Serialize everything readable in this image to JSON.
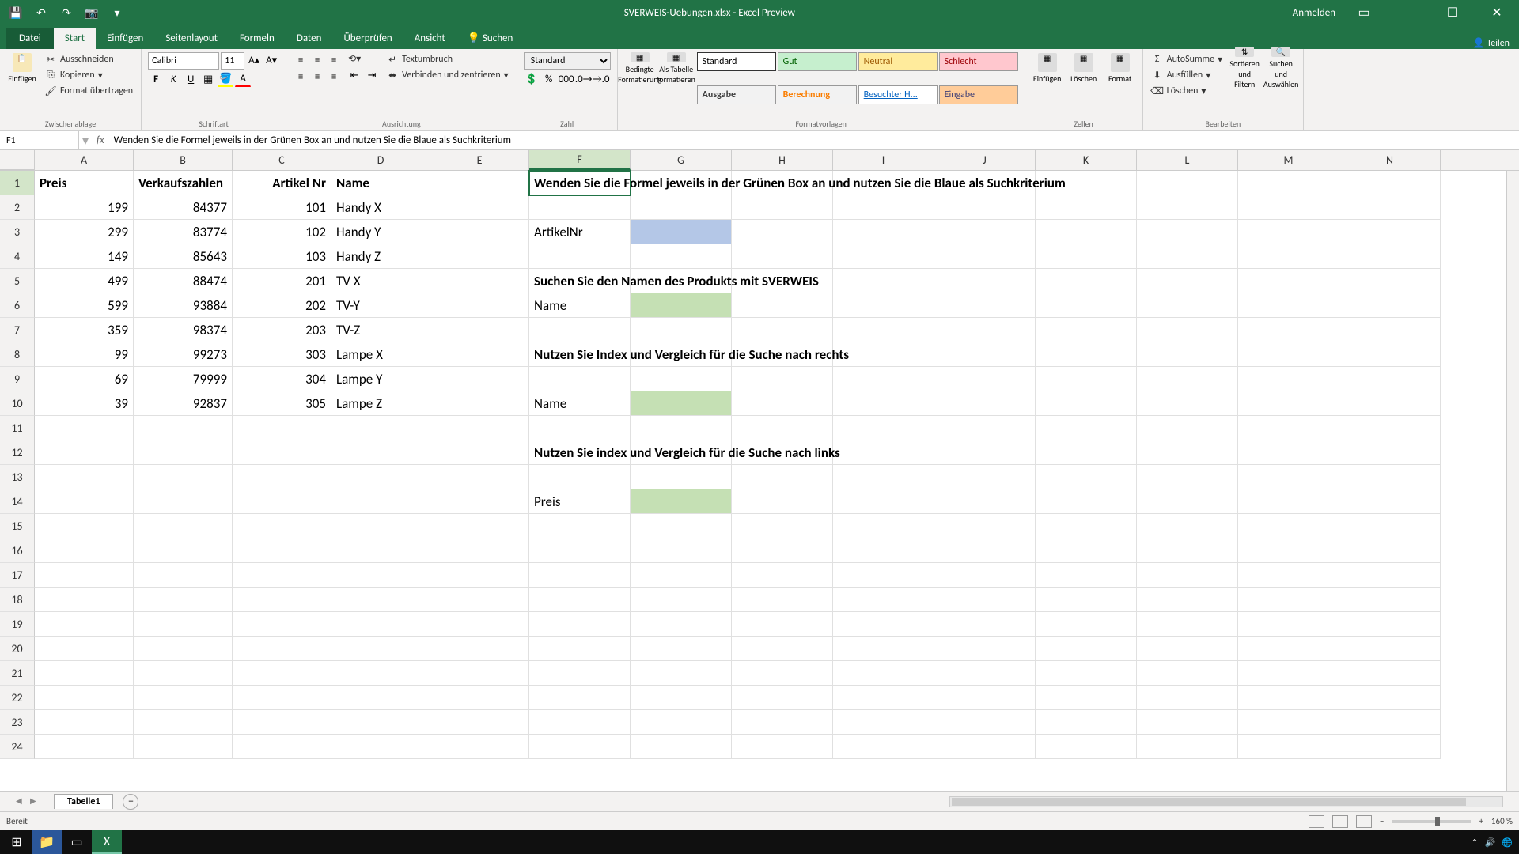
{
  "titlebar": {
    "title": "SVERWEIS-Uebungen.xlsx - Excel Preview",
    "signin": "Anmelden"
  },
  "tabs": {
    "datei": "Datei",
    "start": "Start",
    "einfuegen": "Einfügen",
    "seitenlayout": "Seitenlayout",
    "formeln": "Formeln",
    "daten": "Daten",
    "ueberpruefen": "Überprüfen",
    "ansicht": "Ansicht",
    "suchen": "Suchen",
    "teilen": "Teilen"
  },
  "ribbon": {
    "einfuegen": "Einfügen",
    "ausschneiden": "Ausschneiden",
    "kopieren": "Kopieren",
    "format_uebertragen": "Format übertragen",
    "zwischenablage": "Zwischenablage",
    "font_name": "Calibri",
    "font_size": "11",
    "schriftart": "Schriftart",
    "textumbruch": "Textumbruch",
    "verbinden": "Verbinden und zentrieren",
    "ausrichtung": "Ausrichtung",
    "number_format": "Standard",
    "zahl": "Zahl",
    "bedingte": "Bedingte\nFormatierung",
    "als_tabelle": "Als Tabelle\nformatieren",
    "style_standard": "Standard",
    "style_gut": "Gut",
    "style_neutral": "Neutral",
    "style_schlecht": "Schlecht",
    "style_ausgabe": "Ausgabe",
    "style_berechnung": "Berechnung",
    "style_besuchter": "Besuchter H...",
    "style_eingabe": "Eingabe",
    "formatvorlagen": "Formatvorlagen",
    "r_einfuegen": "Einfügen",
    "loeschen": "Löschen",
    "format": "Format",
    "zellen": "Zellen",
    "autosumme": "AutoSumme",
    "ausfuellen": "Ausfüllen",
    "r_loeschen": "Löschen",
    "sortieren": "Sortieren und\nFiltern",
    "suchen_auswaehlen": "Suchen und\nAuswählen",
    "bearbeiten": "Bearbeiten"
  },
  "formula": {
    "name_box": "F1",
    "value": "Wenden Sie die Formel jeweils in der Grünen Box an und nutzen Sie die Blaue als Suchkriterium"
  },
  "columns": [
    "A",
    "B",
    "C",
    "D",
    "E",
    "F",
    "G",
    "H",
    "I",
    "J",
    "K",
    "L",
    "M",
    "N"
  ],
  "headers": {
    "A1": "Preis",
    "B1": "Verkaufszahlen",
    "C1": "Artikel Nr",
    "D1": "Name"
  },
  "data_rows": [
    {
      "preis": "199",
      "verkauf": "84377",
      "artikel": "101",
      "name": "Handy X"
    },
    {
      "preis": "299",
      "verkauf": "83774",
      "artikel": "102",
      "name": "Handy Y"
    },
    {
      "preis": "149",
      "verkauf": "85643",
      "artikel": "103",
      "name": "Handy Z"
    },
    {
      "preis": "499",
      "verkauf": "88474",
      "artikel": "201",
      "name": "TV X"
    },
    {
      "preis": "599",
      "verkauf": "93884",
      "artikel": "202",
      "name": "TV-Y"
    },
    {
      "preis": "359",
      "verkauf": "98374",
      "artikel": "203",
      "name": "TV-Z"
    },
    {
      "preis": "99",
      "verkauf": "99273",
      "artikel": "303",
      "name": "Lampe X"
    },
    {
      "preis": "69",
      "verkauf": "79999",
      "artikel": "304",
      "name": "Lampe Y"
    },
    {
      "preis": "39",
      "verkauf": "92837",
      "artikel": "305",
      "name": "Lampe Z"
    }
  ],
  "instructions": {
    "F1": "Wenden Sie die Formel jeweils in der Grünen Box an und nutzen Sie die Blaue als Suchkriterium",
    "F3": "ArtikelNr",
    "F5": "Suchen Sie den Namen des Produkts mit SVERWEIS",
    "F6": "Name",
    "F8": "Nutzen Sie Index und Vergleich für die Suche nach rechts",
    "F10": "Name",
    "F12": "Nutzen Sie index und Vergleich für die Suche nach links",
    "F14": "Preis"
  },
  "sheet": {
    "tab1": "Tabelle1"
  },
  "status": {
    "ready": "Bereit",
    "zoom": "160 %"
  }
}
